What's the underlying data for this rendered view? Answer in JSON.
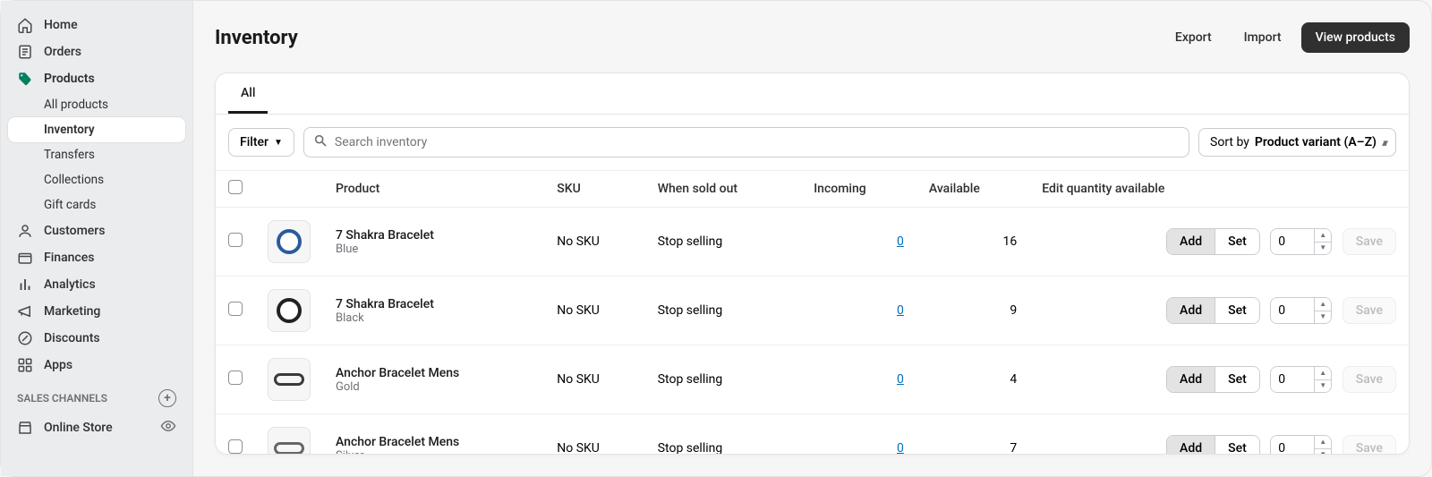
{
  "sidebar": {
    "items": [
      {
        "label": "Home",
        "icon": "home"
      },
      {
        "label": "Orders",
        "icon": "orders"
      },
      {
        "label": "Products",
        "icon": "products",
        "active": true,
        "children": [
          {
            "label": "All products"
          },
          {
            "label": "Inventory",
            "active": true
          },
          {
            "label": "Transfers"
          },
          {
            "label": "Collections"
          },
          {
            "label": "Gift cards"
          }
        ]
      },
      {
        "label": "Customers",
        "icon": "customers"
      },
      {
        "label": "Finances",
        "icon": "finances"
      },
      {
        "label": "Analytics",
        "icon": "analytics"
      },
      {
        "label": "Marketing",
        "icon": "marketing"
      },
      {
        "label": "Discounts",
        "icon": "discounts"
      },
      {
        "label": "Apps",
        "icon": "apps"
      }
    ],
    "section_title": "SALES CHANNELS",
    "channels": [
      {
        "label": "Online Store",
        "icon": "store"
      }
    ]
  },
  "page": {
    "title": "Inventory"
  },
  "actions": {
    "export": "Export",
    "import": "Import",
    "view_products": "View products"
  },
  "tabs": [
    {
      "label": "All",
      "active": true
    }
  ],
  "toolbar": {
    "filter_label": "Filter",
    "search_placeholder": "Search inventory",
    "sort_prefix": "Sort by ",
    "sort_value": "Product variant (A–Z)"
  },
  "columns": {
    "product": "Product",
    "sku": "SKU",
    "when_sold_out": "When sold out",
    "incoming": "Incoming",
    "available": "Available",
    "edit_qty": "Edit quantity available"
  },
  "row_labels": {
    "add": "Add",
    "set": "Set",
    "save": "Save"
  },
  "rows": [
    {
      "name": "7 Shakra Bracelet",
      "variant": "Blue",
      "sku": "No SKU",
      "when_sold_out": "Stop selling",
      "incoming": "0",
      "available": "16",
      "qty": "0",
      "thumb": "ring-blue"
    },
    {
      "name": "7 Shakra Bracelet",
      "variant": "Black",
      "sku": "No SKU",
      "when_sold_out": "Stop selling",
      "incoming": "0",
      "available": "9",
      "qty": "0",
      "thumb": "ring-black"
    },
    {
      "name": "Anchor Bracelet Mens",
      "variant": "Gold",
      "sku": "No SKU",
      "when_sold_out": "Stop selling",
      "incoming": "0",
      "available": "4",
      "qty": "0",
      "thumb": "anchor-gold"
    },
    {
      "name": "Anchor Bracelet Mens",
      "variant": "Silver",
      "sku": "No SKU",
      "when_sold_out": "Stop selling",
      "incoming": "0",
      "available": "7",
      "qty": "0",
      "thumb": "anchor-silver"
    }
  ]
}
